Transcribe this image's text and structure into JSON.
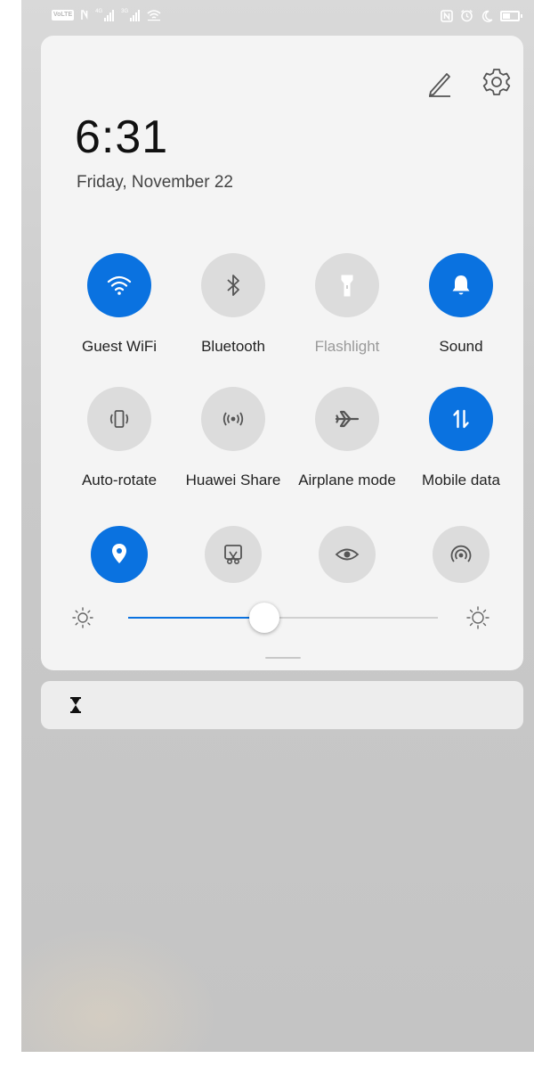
{
  "status_bar": {
    "volte_label": "VoLTE",
    "sim1_label": "4G",
    "sim2_label": "3G",
    "left_icons": [
      "volte-icon",
      "nfc-n-icon",
      "signal-icon",
      "signal-icon",
      "wifi-icon"
    ],
    "right_icons": [
      "nfc-icon",
      "alarm-icon",
      "moon-icon",
      "battery-icon"
    ]
  },
  "header": {
    "time": "6:31",
    "date": "Friday, November 22",
    "edit_icon": "pencil-icon",
    "settings_icon": "gear-icon"
  },
  "tiles": [
    {
      "label": "Guest WiFi",
      "icon": "wifi-icon",
      "state": "on"
    },
    {
      "label": "Bluetooth",
      "icon": "bluetooth-icon",
      "state": "off"
    },
    {
      "label": "Flashlight",
      "icon": "flashlight-icon",
      "state": "disabled"
    },
    {
      "label": "Sound",
      "icon": "bell-icon",
      "state": "on"
    },
    {
      "label": "Auto-rotate",
      "icon": "auto-rotate-icon",
      "state": "off"
    },
    {
      "label": "Huawei Share",
      "icon": "huawei-share-icon",
      "state": "off"
    },
    {
      "label": "Airplane mode",
      "icon": "airplane-icon",
      "state": "off"
    },
    {
      "label": "Mobile data",
      "icon": "mobile-data-icon",
      "state": "on"
    },
    {
      "label": "",
      "icon": "location-icon",
      "state": "on"
    },
    {
      "label": "",
      "icon": "screenshot-icon",
      "state": "off"
    },
    {
      "label": "",
      "icon": "eye-comfort-icon",
      "state": "off"
    },
    {
      "label": "",
      "icon": "hotspot-icon",
      "state": "off"
    }
  ],
  "brightness": {
    "level": 0.44
  },
  "notification": {
    "icon": "hourglass-icon"
  },
  "colors": {
    "accent": "#0a72e0",
    "tile_off": "#dcdcdc",
    "panel_bg": "#f4f4f4"
  }
}
